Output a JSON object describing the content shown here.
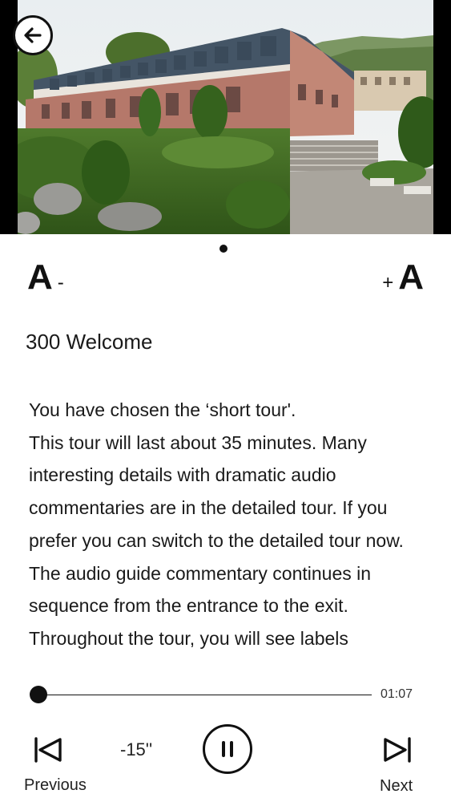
{
  "header": {
    "back_icon": "arrow-left-icon",
    "image_description_icon": "museum-photo"
  },
  "font_controls": {
    "decrease_letter": "A",
    "decrease_sign": "-",
    "increase_sign": "+",
    "increase_letter": "A"
  },
  "stop": {
    "title": "300 Welcome",
    "paragraphs": [
      "You have chosen the ‘short tour'.",
      "This tour will last about 35 minutes. Many interesting details with  dramatic audio commentaries are in the detailed tour.  If you prefer you can switch to the detailed tour now.",
      "The audio guide commentary continues in sequence from the entrance to the exit.",
      "Throughout the tour, you will see labels"
    ]
  },
  "player": {
    "progress_fraction": 0.0,
    "elapsed_time": "01:07",
    "previous_label": "Previous",
    "rewind_label": "-15''",
    "next_label": "Next",
    "previous_icon": "skip-previous-icon",
    "pause_icon": "pause-icon",
    "next_icon": "skip-next-icon"
  },
  "colors": {
    "foreground": "#111111",
    "background": "#ffffff"
  }
}
